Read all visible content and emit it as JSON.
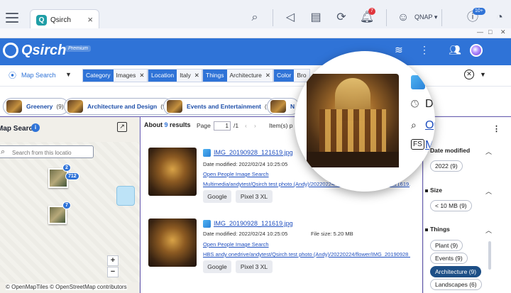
{
  "taskbar": {
    "app_tab": "Qsirch",
    "notification_count": "7",
    "user": "QNAP ▾",
    "updates_badge": "10+"
  },
  "header": {
    "brand": "Qsirch",
    "edition": "Premium"
  },
  "search": {
    "mode": "Map Search",
    "filters": [
      {
        "key": "Category",
        "value": "Images"
      },
      {
        "key": "Location",
        "value": "Italy"
      },
      {
        "key": "Things",
        "value": "Architecture"
      },
      {
        "key": "Color",
        "value": "Bro"
      }
    ]
  },
  "categories": [
    {
      "label": "Greenery",
      "count": "(9)"
    },
    {
      "label": "Architecture and Design",
      "count": "(9)"
    },
    {
      "label": "Events and Entertainment",
      "count": "(9)"
    },
    {
      "label": "N",
      "count": ""
    }
  ],
  "map": {
    "title": "Map Search",
    "search_placeholder": "Search from this locatio",
    "cluster_counts": [
      "2",
      "712",
      "7"
    ],
    "zoom_in": "+",
    "zoom_out": "−",
    "attribution": "© OpenMapTiles © OpenStreetMap contributors"
  },
  "results": {
    "about_prefix": "About ",
    "about_count": "9",
    "about_suffix": " results",
    "page_label": "Page",
    "page_value": "1",
    "page_total": "/1",
    "items_label": "Item(s) p",
    "items": [
      {
        "name": "IMG_20190928_121619.jpg",
        "date": "Date modified: 2022/02/24 10:25:05",
        "filesize": "",
        "people_link": "Open People Image Search",
        "path": "Multimedia/andytest/Qsirch test photo (Andy)/20220224/flower/IMG_20190928_121619.jpg",
        "tags": [
          "Google",
          "Pixel 3 XL"
        ]
      },
      {
        "name": "IMG_20190928_121619.jpg",
        "date": "Date modified: 2022/02/24 10:25:05",
        "filesize": "File size: 5.20 MB",
        "people_link": "Open People Image Search",
        "path": "HBS andy onedrive/andytest/Qsirch test photo (Andy)/20220224/flower/IMG_20190928_1",
        "tags": [
          "Google",
          "Pixel 3 XL"
        ]
      }
    ]
  },
  "filters_pane": {
    "date_modified": {
      "title": "Date modified",
      "chips": [
        "2022 (9)"
      ]
    },
    "size": {
      "title": "Size",
      "chips": [
        "< 10 MB (9)"
      ]
    },
    "things": {
      "title": "Things",
      "chips": [
        "Plant (9)",
        "Events (9)",
        "Architecture (9)",
        "Landscapes (6)"
      ],
      "selected": "Architecture (9)"
    }
  },
  "magnifier": {
    "rows": [
      "Da",
      "Op",
      "Di",
      "M"
    ]
  }
}
